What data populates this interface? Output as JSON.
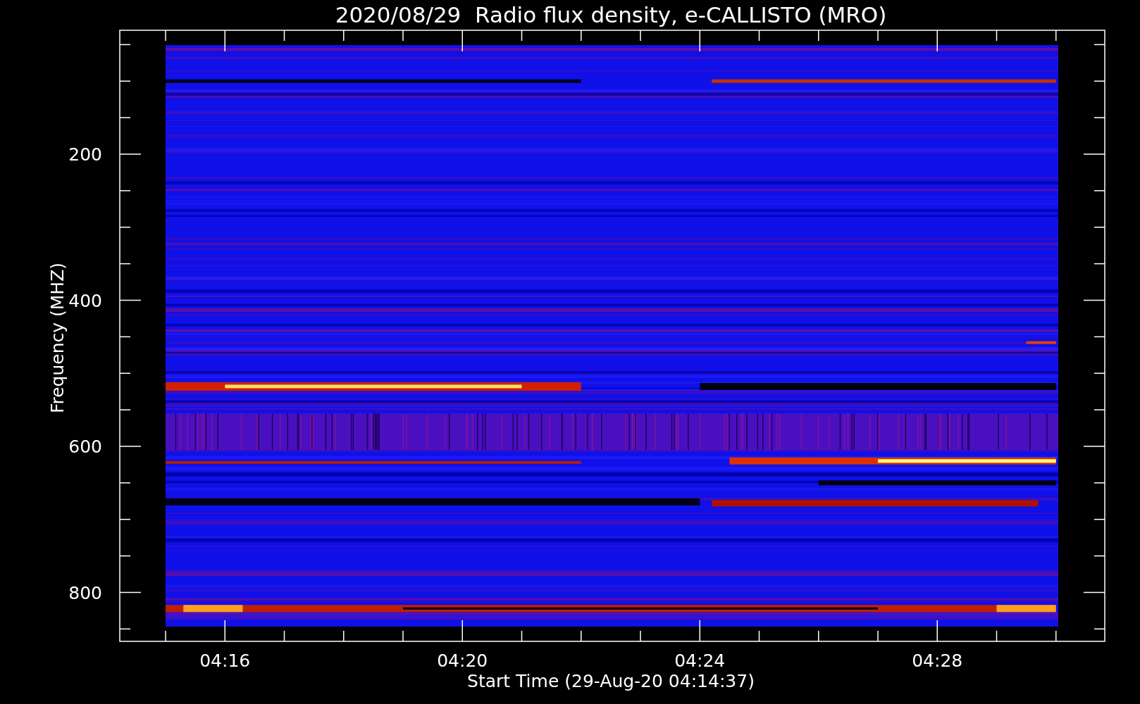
{
  "title": "2020/08/29  Radio flux density, e-CALLISTO (MRO)",
  "y_axis": {
    "label": "Frequency (MHZ)",
    "ticks": [
      "200",
      "400",
      "600",
      "800"
    ]
  },
  "x_axis": {
    "label": "Start Time (29-Aug-20 04:14:37)",
    "ticks": [
      "04:16",
      "04:20",
      "04:24",
      "04:28"
    ]
  }
}
